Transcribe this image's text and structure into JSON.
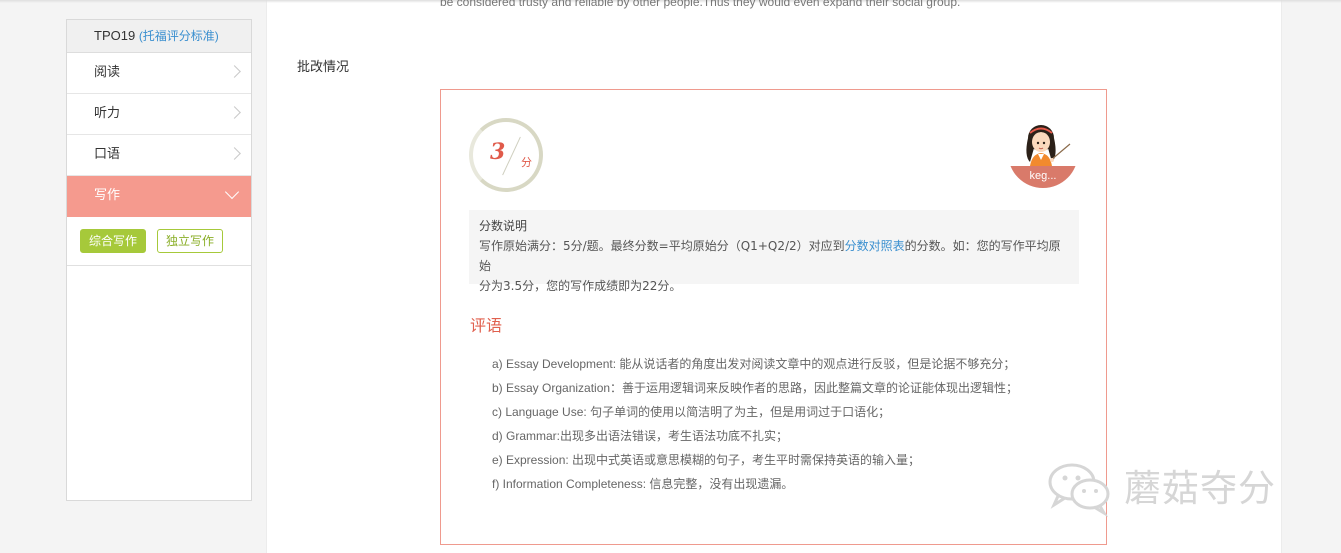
{
  "top_text": "be considered trusty and reliable by other people.Thus they would even expand their social group.",
  "sidebar": {
    "title": "TPO19",
    "title_link": "(托福评分标准)",
    "items": [
      {
        "label": "阅读"
      },
      {
        "label": "听力"
      },
      {
        "label": "口语"
      },
      {
        "label": "写作"
      }
    ],
    "subtabs": [
      {
        "label": "综合写作"
      },
      {
        "label": "独立写作"
      }
    ]
  },
  "main": {
    "section_label": "批改情况",
    "score": {
      "value": "3",
      "unit": "分"
    },
    "teacher": {
      "name": "keg..."
    },
    "score_explain": {
      "title": "分数说明",
      "line1_pre": "写作原始满分：5分/题。最终分数=平均原始分（Q1+Q2/2）对应到",
      "link": "分数对照表",
      "line1_post": "的分数。如：您的写作平均原始",
      "line2": "分为3.5分，您的写作成绩即为22分。"
    },
    "comment_title": "评语",
    "comments": [
      "a) Essay Development: 能从说话者的角度出发对阅读文章中的观点进行反驳，但是论据不够充分；",
      "b) Essay Organization：善于运用逻辑词来反映作者的思路，因此整篇文章的论证能体现出逻辑性；",
      "c) Language Use: 句子单词的使用以简洁明了为主，但是用词过于口语化；",
      "d) Grammar:出现多出语法错误，考生语法功底不扎实；",
      "e) Expression: 出现中式英语或意思模糊的句子，考生平时需保持英语的输入量；",
      "f) Information Completeness: 信息完整，没有出现遗漏。"
    ]
  },
  "watermark": {
    "text": "蘑菇夺分"
  },
  "colors": {
    "accent": "#f59a8e",
    "green": "#a6c93a",
    "link": "#3a8fcf",
    "red_text": "#e0604e"
  }
}
